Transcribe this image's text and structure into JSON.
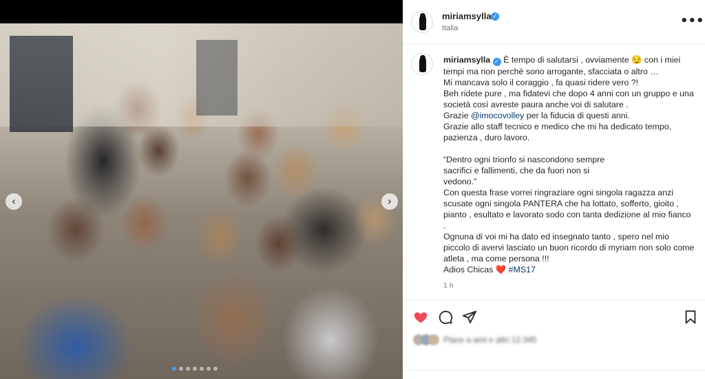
{
  "post": {
    "username": "miriamsylla",
    "location": "Italia",
    "more_label": "•••",
    "timestamp": "1 h",
    "caption_user": "miriamsylla",
    "caption_line1": "È tempo di salutarsi , ovviamente 😏 con i miei tempi ma non perché sono arrogante, sfacciata o altro …",
    "caption_line2": "Mi mancava solo il coraggio , fa quasi ridere vero ?!",
    "caption_line3": "Beh ridete pure , ma fidatevi che dopo 4 anni con un gruppo e una società così avreste paura anche voi di salutare .",
    "caption_line4_before": "Grazie ",
    "caption_line4_mention": "@imocovolley",
    "caption_line4_after": " per la fiducia di questi anni.",
    "caption_line5": "Grazie allo staff tecnico e medico che mi ha dedicato tempo, pazienza , duro lavoro.",
    "quote_line1": "“Dentro ogni trionfo si nascondono sempre",
    "quote_line2": "sacrifici e fallimenti, che da fuori non si",
    "quote_line3": "vedono.”",
    "caption_line6": "Con questa frase vorrei ringraziare ogni singola ragazza anzi scusate ogni singola PANTERA che ha lottato, sofferto, gioito , pianto , esultato e lavorato sodo con tanta dedizione al mio fianco .",
    "caption_line7": "Ognuna di voi mi ha dato ed insegnato tanto , spero nel mio piccolo di avervi lasciato un buon ricordo di myriam non solo come atleta , ma come persona !!!",
    "caption_line8_before": "Adios Chicas ❤️ ",
    "caption_hashtag": "#MS17",
    "likes_text": "Piace a ami e altri 12.345"
  },
  "media": {
    "prev_arrow": "‹",
    "next_arrow": "›",
    "slide_count": 7,
    "active_slide": 1
  },
  "icons": {
    "like": "heart-filled-icon",
    "comment": "comment-icon",
    "share": "paper-plane-icon",
    "save": "bookmark-icon",
    "verified": "verified-badge-icon",
    "more": "more-options-icon"
  },
  "colors": {
    "like": "#ed4956",
    "verified": "#3797f0",
    "link": "#00376b"
  }
}
